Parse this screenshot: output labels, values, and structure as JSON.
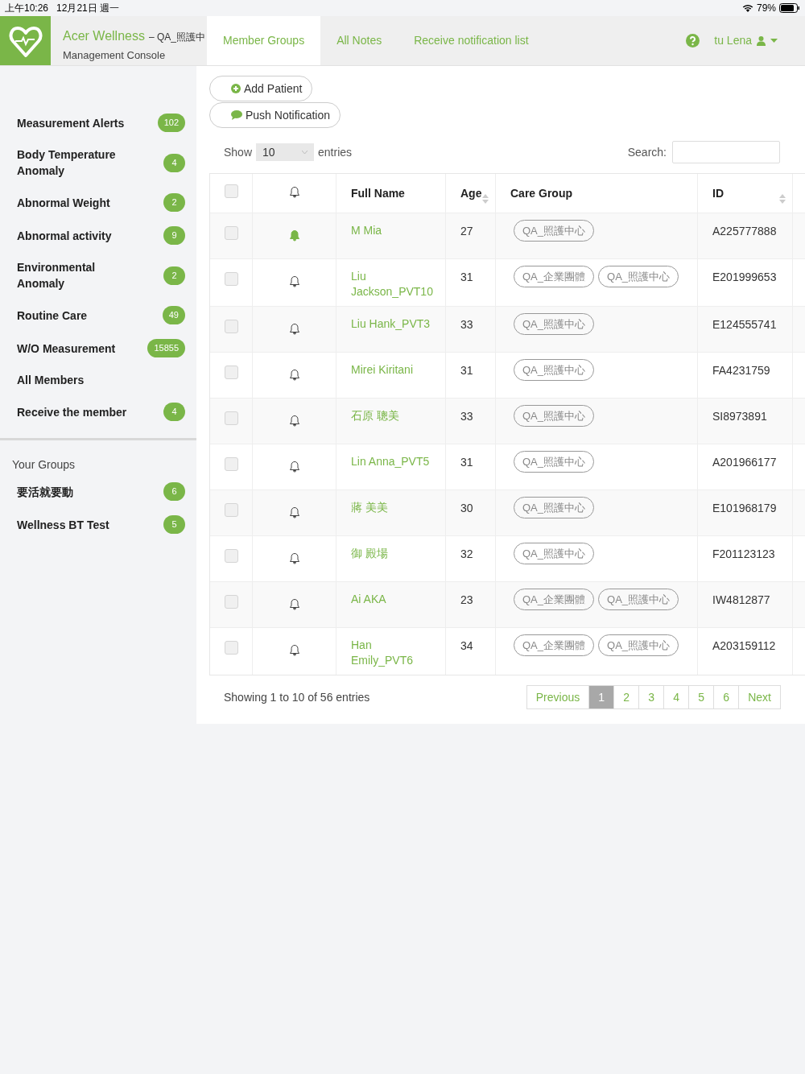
{
  "status_bar": {
    "time": "上午10:26",
    "date": "12月21日 週一",
    "battery": "79%"
  },
  "header": {
    "app_name": "Acer Wellness",
    "group": "– QA_照護中",
    "subtitle": "Management Console",
    "user": "tu Lena"
  },
  "tabs": [
    {
      "label": "Member Groups",
      "selected": true
    },
    {
      "label": "All Notes",
      "selected": false
    },
    {
      "label": "Receive notification list",
      "selected": false
    }
  ],
  "sidebar": {
    "items": [
      {
        "label": "Measurement Alerts",
        "count": "102"
      },
      {
        "label": "Body Temperature Anomaly",
        "count": "4"
      },
      {
        "label": "Abnormal Weight",
        "count": "2"
      },
      {
        "label": "Abnormal activity",
        "count": "9"
      },
      {
        "label": "Environmental Anomaly",
        "count": "2"
      },
      {
        "label": "Routine Care",
        "count": "49"
      },
      {
        "label": "W/O Measurement",
        "count": "15855"
      },
      {
        "label": "All Members"
      },
      {
        "label": "Receive the member",
        "count": "4"
      }
    ],
    "groups_title": "Your Groups",
    "groups": [
      {
        "label": "要活就要動",
        "count": "6"
      },
      {
        "label": "Wellness BT Test",
        "count": "5"
      }
    ]
  },
  "actions": [
    "Add Patient",
    "Push Notification"
  ],
  "length_menu": {
    "before": "Show",
    "value": "10",
    "after": "entries"
  },
  "search": {
    "label": "Search:"
  },
  "table": {
    "select_all_checked": false,
    "columns": [
      "Full Name",
      "Age",
      "Care Group",
      "ID"
    ],
    "rows": [
      {
        "name": "M Mia",
        "age": "27",
        "groups": [
          "QA_照護中心"
        ],
        "id": "A225777888",
        "checked": false,
        "alert": true
      },
      {
        "name": "Liu Jackson_PVT10",
        "age": "31",
        "groups": [
          "QA_企業團體",
          "QA_照護中心"
        ],
        "id": "E201999653",
        "checked": false,
        "alert": false
      },
      {
        "name": "Liu Hank_PVT3",
        "age": "33",
        "groups": [
          "QA_照護中心"
        ],
        "id": "E124555741",
        "checked": false,
        "alert": false
      },
      {
        "name": "Mirei Kiritani",
        "age": "31",
        "groups": [
          "QA_照護中心"
        ],
        "id": "FA4231759",
        "checked": false,
        "alert": false
      },
      {
        "name": "石原 聰美",
        "age": "33",
        "groups": [
          "QA_照護中心"
        ],
        "id": "SI8973891",
        "checked": false,
        "alert": false
      },
      {
        "name": "Lin Anna_PVT5",
        "age": "31",
        "groups": [
          "QA_照護中心"
        ],
        "id": "A201966177",
        "checked": false,
        "alert": false
      },
      {
        "name": "蔣 美美",
        "age": "30",
        "groups": [
          "QA_照護中心"
        ],
        "id": "E101968179",
        "checked": false,
        "alert": false
      },
      {
        "name": "御 殿場",
        "age": "32",
        "groups": [
          "QA_照護中心"
        ],
        "id": "F201123123",
        "checked": false,
        "alert": false
      },
      {
        "name": "Ai AKA",
        "age": "23",
        "groups": [
          "QA_企業團體",
          "QA_照護中心"
        ],
        "id": "IW4812877",
        "checked": false,
        "alert": false
      },
      {
        "name": "Han Emily_PVT6",
        "age": "34",
        "groups": [
          "QA_企業團體",
          "QA_照護中心"
        ],
        "id": "A203159112",
        "checked": false,
        "alert": false
      }
    ]
  },
  "info": "Showing 1 to 10 of 56 entries",
  "pagination": {
    "previous": "Previous",
    "next": "Next",
    "pages": [
      {
        "label": "1",
        "selected": true
      },
      {
        "label": "2",
        "selected": false
      },
      {
        "label": "3",
        "selected": false
      },
      {
        "label": "4",
        "selected": false
      },
      {
        "label": "5",
        "selected": false
      },
      {
        "label": "6",
        "selected": false
      }
    ]
  }
}
